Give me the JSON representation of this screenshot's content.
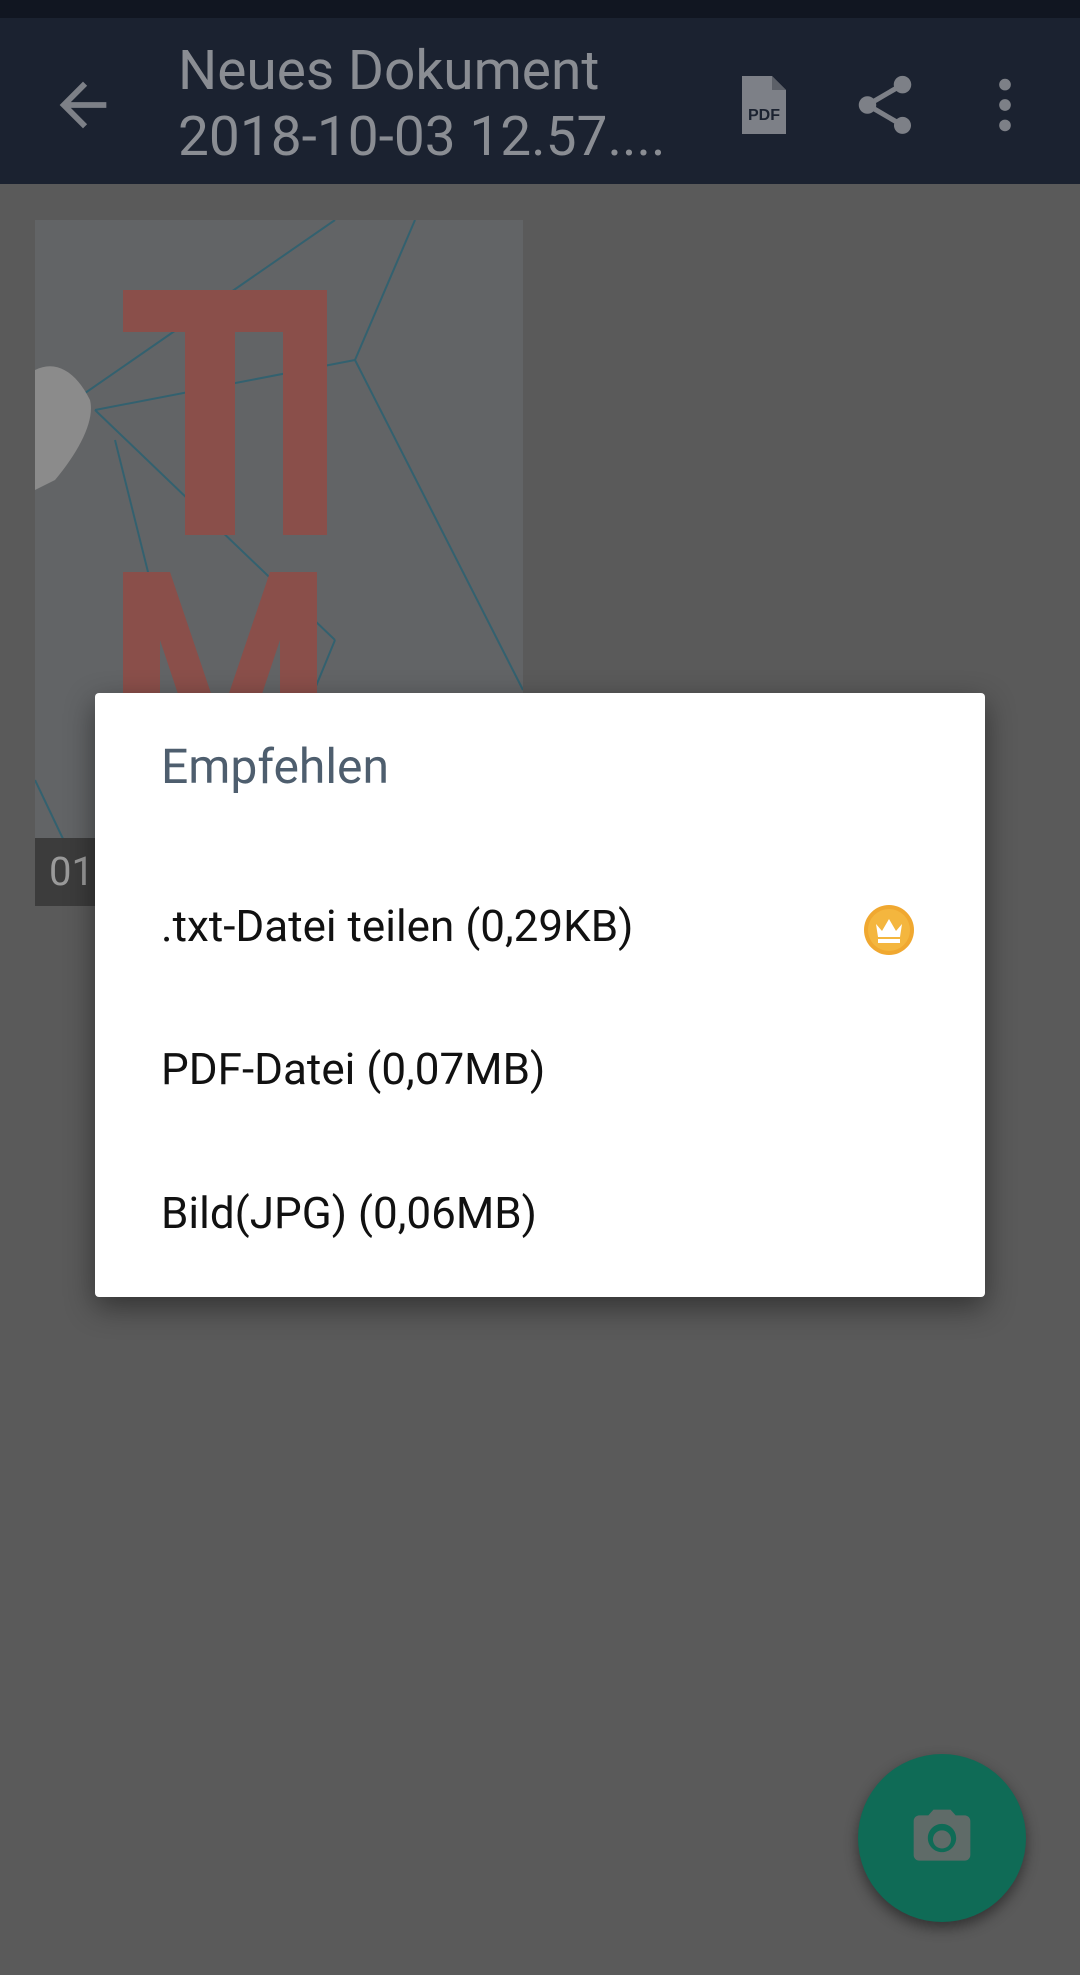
{
  "app_bar": {
    "title_line1": "Neues Dokument",
    "title_line2": "2018-10-03 12.57....",
    "pdf_icon_text": "PDF",
    "icons": [
      "back-arrow-icon",
      "pdf-icon",
      "share-icon",
      "more-vert-icon"
    ]
  },
  "thumbnail": {
    "page_number": "01"
  },
  "dialog": {
    "title": "Empfehlen",
    "options": [
      {
        "label": ".txt-Datei teilen (0,29KB)",
        "premium": true
      },
      {
        "label": "PDF-Datei (0,07MB)",
        "premium": false
      },
      {
        "label": "Bild(JPG) (0,06MB)",
        "premium": false
      }
    ]
  },
  "fab": {
    "icon": "camera-icon"
  },
  "colors": {
    "app_bar": "#1b2230",
    "dialog_title": "#4e5e6e",
    "fab": "#0f6b56",
    "crown_badge": "#f0a830"
  }
}
